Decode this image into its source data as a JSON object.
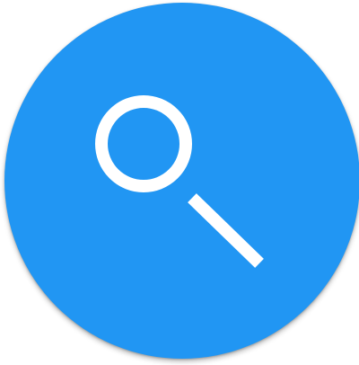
{
  "search_fab": {
    "icon": "search-icon",
    "colors": {
      "background": "#2196F3",
      "icon": "#FFFFFF"
    }
  }
}
